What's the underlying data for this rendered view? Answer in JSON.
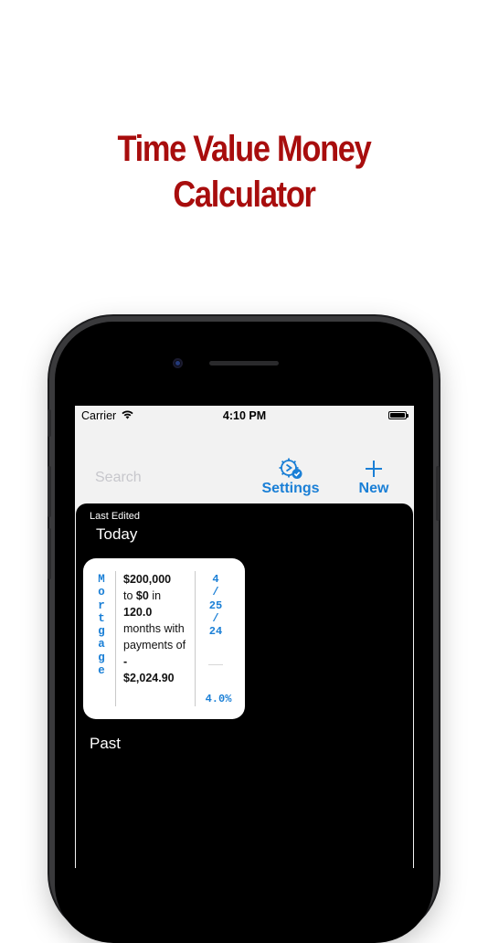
{
  "promo": {
    "title_line1": "Time Value Money",
    "title_line2": "Calculator"
  },
  "status_bar": {
    "carrier": "Carrier",
    "time": "4:10 PM"
  },
  "nav_bar": {
    "search_placeholder": "Search",
    "settings_label": "Settings",
    "new_label": "New",
    "accent_color": "#1a7fd6"
  },
  "list": {
    "caption": "Last Edited",
    "today_heading": "Today",
    "past_heading": "Past",
    "cards": [
      {
        "type": "Mortgage",
        "principal": "$200,000",
        "to_word": "to",
        "future_value": "$0",
        "in_word": "in",
        "periods": "120.0",
        "months_text": "months with payments of",
        "payment_sign": "-",
        "payment": "$2,024.90",
        "date_lines": [
          "4",
          "/",
          "25",
          "/",
          "24"
        ],
        "rate": "4.0%"
      }
    ]
  }
}
